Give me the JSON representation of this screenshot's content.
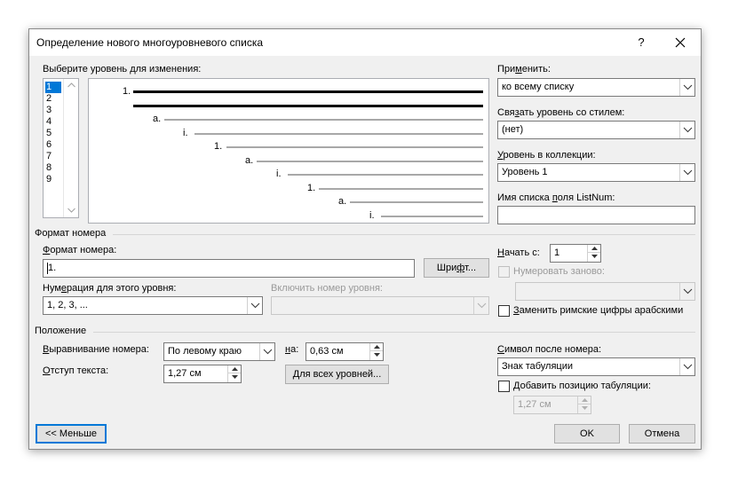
{
  "dialog": {
    "title": "Определение нового многоуровневого списка",
    "help": "?"
  },
  "level_select": {
    "label": "Выберите уровень для изменения:",
    "items": [
      "1",
      "2",
      "3",
      "4",
      "5",
      "6",
      "7",
      "8",
      "9"
    ],
    "selected": "1"
  },
  "preview": {
    "rows": [
      "1.",
      "",
      "a.",
      "i.",
      "1.",
      "a.",
      "i.",
      "1.",
      "a.",
      "i."
    ]
  },
  "apply": {
    "label": "Применить:",
    "value": "ко всему списку"
  },
  "link_style": {
    "label": "Связать уровень со стилем:",
    "value": "(нет)"
  },
  "gallery_level": {
    "label": "Уровень в коллекции:",
    "value": "Уровень 1"
  },
  "listnum": {
    "label": "Имя списка поля ListNum:",
    "value": ""
  },
  "number_format": {
    "section": "Формат номера",
    "format_label": "Формат номера:",
    "format_value": "1.",
    "font_button": "Шрифт...",
    "style_label": "Нумерация для этого уровня:",
    "style_value": "1, 2, 3, ...",
    "include_label": "Включить номер уровня:",
    "include_value": "",
    "start_label": "Начать с:",
    "start_value": "1",
    "restart_label": "Нумеровать заново:",
    "restart_value": "",
    "legal_label": "Заменить римские цифры арабскими"
  },
  "position": {
    "section": "Положение",
    "align_label": "Выравнивание номера:",
    "align_value": "По левому краю",
    "at_label": "на:",
    "at_value": "0,63 см",
    "indent_label": "Отступ текста:",
    "indent_value": "1,27 см",
    "all_levels_button": "Для всех уровней...",
    "follow_label": "Символ после номера:",
    "follow_value": "Знак табуляции",
    "add_tab_label": "Добавить позицию табуляции:",
    "tab_value": "1,27 см"
  },
  "footer": {
    "less_button": "<< Меньше",
    "ok_button": "OK",
    "cancel_button": "Отмена"
  }
}
